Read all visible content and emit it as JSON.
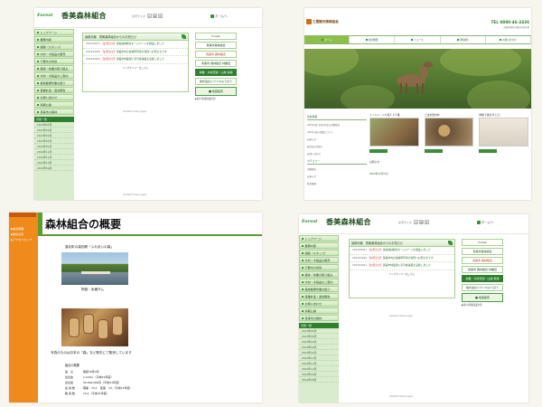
{
  "forest_site": {
    "logo_text": "Forest",
    "title": "香美森林組合",
    "fontsize_label": "文字サイズ",
    "fontsize_options": [
      "小",
      "中",
      "大"
    ],
    "home_link": "ホームへ",
    "nav": [
      "トップページ",
      "業務内容",
      "組織（スタッフ）",
      "木材・木製品の販売",
      "不要木の伐採",
      "森林・林業の取り組み",
      "木材・木製品のご案内",
      "森林整備作業の紹介",
      "事業計画・運営報告",
      "お問い合わせ",
      "情報公開",
      "香美市の森林"
    ],
    "archive_heading": "月別一覧",
    "archive": [
      "2013年05月",
      "2013年04月",
      "2013年03月",
      "2013年02月",
      "2013年01月",
      "2012年12月",
      "2012年11月",
      "2012年10月",
      "2012年09月",
      "2012年08月"
    ],
    "news_heading": "最新情報",
    "news_subheading": "香美森林組合からのお知らせ",
    "news": [
      {
        "date": "2013/05/01",
        "tag": "【お知らせ】",
        "text": "香美森林組合ホームページを開設しました"
      },
      {
        "date": "2013/04/20",
        "tag": "【お知らせ】",
        "text": "香美市内の森林所有者の皆様へお知らせです"
      },
      {
        "date": "2013/04/01",
        "tag": "【お知らせ】",
        "text": "香美市林業担い手育成事業を実施しました"
      }
    ],
    "news_more": "バックナンバーはこちら",
    "plugin_note": "Content Tools plugin",
    "banners": [
      {
        "label": "Forest",
        "style": "plain"
      },
      {
        "label": "香美市森林組合",
        "style": "plain"
      },
      {
        "label": "香美市 森林組合",
        "style": "orange"
      },
      {
        "label": "香美市 森林組合 林業班",
        "style": "plain"
      },
      {
        "label": "林業・木材流通・山林 情報",
        "style": "dark"
      },
      {
        "label": "株式会社ミクニちゅうほう",
        "style": "plain"
      }
    ],
    "map_badge": "地図検索",
    "right_link": "▶個人情報保護方針"
  },
  "corporate_site": {
    "top_tiny_left": "",
    "logo_text": "三豊観光情報協会",
    "tel": "TEL 0880-46-2436",
    "addr": "高知県香美市香北町韮生野 ",
    "nav": [
      "ホーム",
      "組合概要",
      "ニュース",
      "活動報告",
      "お問い合わせ"
    ],
    "left_heading": "新着情報",
    "left_items": [
      "2022年度 令和4年度の活動報告",
      "2021年度の活動について",
      "お知らせ",
      "組合員の皆様へ",
      "お問い合わせ"
    ],
    "left_heading2": "カテゴリー",
    "left_items2": [
      "活動報告",
      "お知らせ",
      "組合概要"
    ],
    "cards": [
      {
        "title": "イノシシ・シカ罠１１０番",
        "img_color": "#8a6a46"
      },
      {
        "title": "ご注文受付中",
        "img_color": "#6b5239"
      },
      {
        "title": "仲間で森を育てる！",
        "img_color": "#d8d0c2"
      }
    ],
    "lower_title": "お知らせ",
    "lower_date": "2022年11月15日"
  },
  "overview_doc": {
    "left_nav": [
      "▶組合概要",
      "▶組合沿革",
      "▶アクセスマップ"
    ],
    "title": "森林組合の概要",
    "caption1": "香北町の高知県「ふれあいの森」",
    "caption2": "物部・永瀬ダム",
    "caption3": "写真のものは日本の「森」など県内にて販売しています",
    "table_heading": "組合の概要",
    "table": [
      {
        "k": "設　立",
        "v": "昭和30年4月"
      },
      {
        "k": "出資金",
        "v": "1,118人（平成21年度）"
      },
      {
        "k": "出資金",
        "v": "50,564,000円（平成21年度）"
      },
      {
        "k": "役 員 数",
        "v": "理事　15人　監事　3人（平成21年度）"
      },
      {
        "k": "職 員 数",
        "v": "15人（平成21年度）"
      }
    ]
  },
  "colors": {
    "forest_green": "#2f7f2f",
    "light_green": "#d9eccd",
    "orange": "#f08a1c",
    "background": "#f7f6ee"
  }
}
